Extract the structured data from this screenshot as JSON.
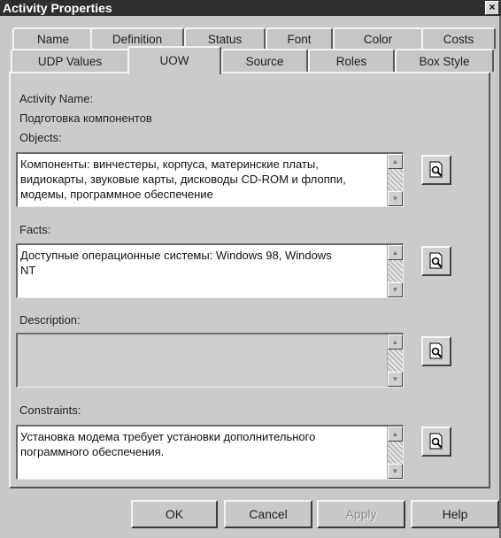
{
  "window": {
    "title": "Activity Properties",
    "close_glyph": "×"
  },
  "tabs_row1": [
    "Name",
    "Definition",
    "Status",
    "Font",
    "Color",
    "Costs"
  ],
  "tabs_row2": [
    "UDP Values",
    "UOW",
    "Source",
    "Roles",
    "Box Style"
  ],
  "active_tab": "UOW",
  "activity_name": {
    "label": "Activity Name:",
    "value": "Подготовка компонентов"
  },
  "objects": {
    "label": "Objects:",
    "value": "Компоненты: винчестеры, корпуса, материнские платы,\nвидиокарты, звуковые карты, дисководы CD-ROM и флоппи,\nмодемы, программное обеспечение"
  },
  "facts": {
    "label": "Facts:",
    "value": "Доступные операционные системы: Windows 98, Windows\nNT"
  },
  "description": {
    "label": "Description:",
    "value": ""
  },
  "constraints": {
    "label": "Constraints:",
    "value": "Установка модема требует установки дополнительного\nпограммного обеспечения."
  },
  "buttons": {
    "ok": "OK",
    "cancel": "Cancel",
    "apply": "Apply",
    "help": "Help"
  }
}
